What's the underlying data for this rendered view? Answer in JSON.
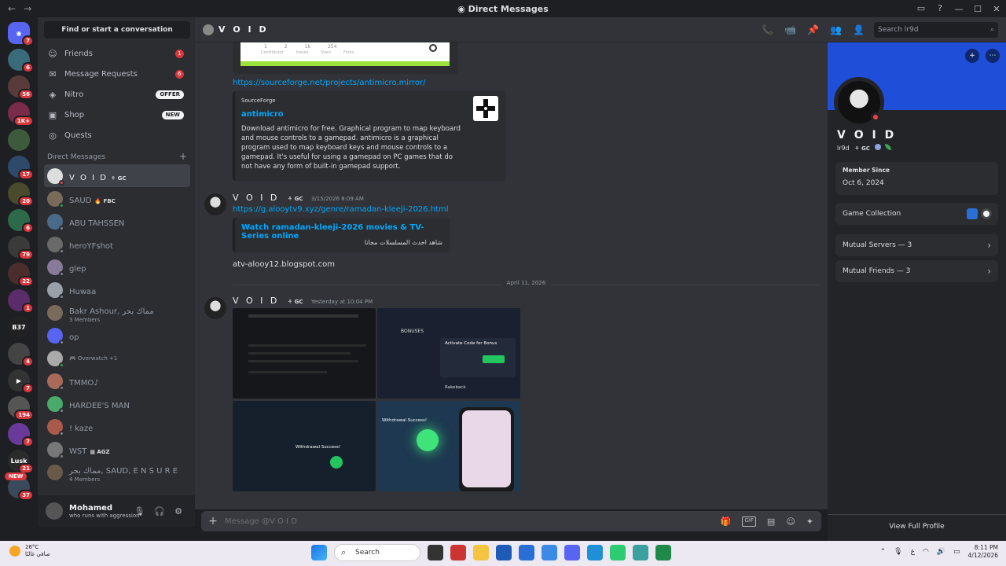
{
  "window": {
    "title": "Direct Messages",
    "back": "←",
    "forward": "→",
    "min": "—",
    "max": "☐",
    "close": "✕"
  },
  "servers": [
    {
      "bg": "#5865f2",
      "label": "◉",
      "badge": "7"
    },
    {
      "bg": "#3a6b7a",
      "label": "",
      "badge": "6"
    },
    {
      "bg": "#5a3b3b",
      "label": "",
      "badge": "56"
    },
    {
      "bg": "#7a2b4a",
      "label": "",
      "badge": "1K+"
    },
    {
      "bg": "#3d5a3d",
      "label": "",
      "badge": ""
    },
    {
      "bg": "#2d4a6a",
      "label": "",
      "badge": "17"
    },
    {
      "bg": "#4a4a2d",
      "label": "",
      "badge": "20"
    },
    {
      "bg": "#2d6a4a",
      "label": "",
      "badge": "6"
    },
    {
      "bg": "#3a3a3a",
      "label": "",
      "badge": "79"
    },
    {
      "bg": "#4a2d2d",
      "label": "",
      "badge": "22"
    },
    {
      "bg": "#5a2d6a",
      "label": "",
      "badge": "1"
    },
    {
      "bg": "#222222",
      "label": "B37",
      "badge": ""
    },
    {
      "bg": "#444444",
      "label": "",
      "badge": "4"
    },
    {
      "bg": "#333333",
      "label": "▶",
      "badge": "7"
    },
    {
      "bg": "#555555",
      "label": "",
      "badge": "194"
    },
    {
      "bg": "#6a3a9a",
      "label": "",
      "badge": "7"
    },
    {
      "bg": "#2a2a2a",
      "label": "Lusk",
      "badge": "21"
    },
    {
      "bg": "#3a4a5a",
      "label": "",
      "badge": "37"
    }
  ],
  "rail_new": "NEW",
  "sidebar": {
    "search": "Find or start a conversation",
    "nav": [
      {
        "icon": "☺",
        "label": "Friends",
        "count": "1"
      },
      {
        "icon": "✉",
        "label": "Message Requests",
        "count": "6"
      },
      {
        "icon": "◈",
        "label": "Nitro",
        "pill": "OFFER"
      },
      {
        "icon": "▣",
        "label": "Shop",
        "pill": "NEW"
      },
      {
        "icon": "◎",
        "label": "Quests"
      }
    ],
    "dm_header": "Direct Messages",
    "dm_add": "+",
    "dms": [
      {
        "name": "V O I D",
        "tag": "⚘ GC",
        "active": true,
        "color": "#ddd",
        "status": "#f23f43"
      },
      {
        "name": "SAUD",
        "tag": "🔥 FBC",
        "color": "#7a6a5a",
        "status": "#23a55a"
      },
      {
        "name": "ABU TAHSSEN",
        "color": "#4a6a8a",
        "status": "#80848e"
      },
      {
        "name": "heroYFshot",
        "color": "#6a6a6a",
        "status": "#80848e"
      },
      {
        "name": "glep",
        "color": "#8a7a9a",
        "status": "#80848e"
      },
      {
        "name": "Huwaa",
        "color": "#9aa0a8",
        "status": "#80848e"
      },
      {
        "name": "Bakr Ashour, ﻣﻤﺎﻙ ﺑﺤﺮ",
        "sub": "3 Members",
        "color": "#7a6a5a"
      },
      {
        "name": "op",
        "color": "#5865f2",
        "status": "#80848e"
      },
      {
        "name": "",
        "sub": "🎮 Overwatch +1",
        "color": "#aaa",
        "status": "#23a55a"
      },
      {
        "name": "TMMO♪",
        "color": "#aa6a5a",
        "status": "#80848e"
      },
      {
        "name": "HARDEE'S MAN",
        "color": "#4aaa6a",
        "status": "#80848e"
      },
      {
        "name": "! kaze",
        "color": "#aa5a4a",
        "status": "#80848e"
      },
      {
        "name": "WST",
        "tag": "▦ AGZ",
        "color": "#777",
        "status": "#80848e"
      },
      {
        "name": "ﻣﻤﺎﻙ ﺑﺤﺮ, SAUD, E N S U R E",
        "sub": "4 Members",
        "color": "#6a5a4a"
      }
    ]
  },
  "user": {
    "name": "Mohamed",
    "status": "who runs with aggression",
    "mic": "🎙",
    "headset": "🎧",
    "settings": "⚙"
  },
  "header": {
    "name": "V O I D",
    "icons": [
      "📞",
      "📹",
      "📌",
      "👥",
      "👤"
    ],
    "search_placeholder": "Search lr9d",
    "search_icon": "⌕"
  },
  "chat": {
    "gh_contrib": "Contributor",
    "gh_issues": "Issues",
    "gh_stars": "Stars",
    "gh_forks": "Forks",
    "gh_vals": [
      "1",
      "2",
      "1k",
      "254"
    ],
    "link1": "https://sourceforge.net/projects/antimicro.mirror/",
    "embed1": {
      "provider": "SourceForge",
      "title": "antimicro",
      "desc": "Download antimicro for free. Graphical program to map keyboard and mouse controls to a gamepad. antimicro is a graphical program used to map keyboard keys and mouse controls to a gamepad. It's useful for using a gamepad on PC games that do not have any form of built-in gamepad support."
    },
    "msg2": {
      "author": "V O I D",
      "tag": "⚘ GC",
      "time": "3/15/2026 8:09 AM"
    },
    "link2": "https://g.alooytv9.xyz/genre/ramadan-kleeji-2026.html",
    "embed2": {
      "title": "Watch ramadan-kleeji-2026 movies & TV-Series online",
      "desc": "ﺷﺎﻫﺪ ﺍﺣﺪﺙ ﺍﻟﻤﺴﻠﺴﻼﺕ ﻣﺠﺎﻧﺎ"
    },
    "plain_text": "atv-alooy12.blogspot.com",
    "date_divider": "April 11, 2026",
    "msg3": {
      "author": "V O I D",
      "tag": "⚘ GC",
      "time": "Yesterday at 10:04 PM"
    },
    "shot_texts": {
      "bonuses": "BONUSES",
      "activate": "Activate Code for Bonus",
      "rakeback": "Rakeback",
      "withdraw1": "Withdrawal Success!",
      "withdraw2": "Withdrawal Success!"
    }
  },
  "input": {
    "plus": "+",
    "placeholder": "Message @V O I D",
    "icons": [
      "🎁",
      "GIF",
      "▤",
      "☺",
      "✦"
    ]
  },
  "profile": {
    "name": "V O I D",
    "username": "lr9d",
    "tag": "⚘ GC",
    "member_since_label": "Member Since",
    "member_since": "Oct 6, 2024",
    "game_collection": "Game Collection",
    "mutual_servers": "Mutual Servers — 3",
    "mutual_friends": "Mutual Friends — 3",
    "view_full": "View Full Profile",
    "chev": "›"
  },
  "taskbar": {
    "temp": "26°C",
    "weather": "ﺻﺎﻓﻲ ﻏﺎﻟﺒًﺎ",
    "search": "Search",
    "lang": "ع",
    "time": "8:11 PM",
    "date": "4/12/2026"
  }
}
